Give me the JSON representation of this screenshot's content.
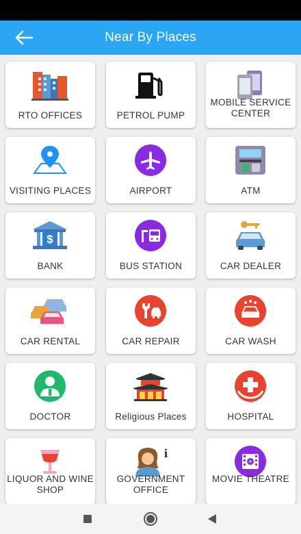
{
  "app_bar": {
    "title": "Near By Places"
  },
  "tiles": [
    {
      "label": "RTO OFFICES",
      "icon": "office-building-icon"
    },
    {
      "label": "PETROL PUMP",
      "icon": "fuel-pump-icon"
    },
    {
      "label": "MOBILE SERVICE CENTER",
      "icon": "mobile-phones-icon"
    },
    {
      "label": "VISITING PLACES",
      "icon": "map-pin-icon"
    },
    {
      "label": "AIRPORT",
      "icon": "airplane-icon"
    },
    {
      "label": "ATM",
      "icon": "atm-machine-icon"
    },
    {
      "label": "BANK",
      "icon": "bank-icon"
    },
    {
      "label": "BUS STATION",
      "icon": "bus-station-icon"
    },
    {
      "label": "CAR DEALER",
      "icon": "car-key-icon"
    },
    {
      "label": "CAR RENTAL",
      "icon": "cars-icon"
    },
    {
      "label": "CAR REPAIR",
      "icon": "car-wrench-icon"
    },
    {
      "label": "CAR WASH",
      "icon": "car-wash-icon"
    },
    {
      "label": "DOCTOR",
      "icon": "doctor-icon"
    },
    {
      "label": "Religious Places",
      "icon": "temple-icon"
    },
    {
      "label": "HOSPITAL",
      "icon": "hospital-cross-icon"
    },
    {
      "label": "LIQUOR AND WINE SHOP",
      "icon": "wine-glass-icon"
    },
    {
      "label": "GOVERNMENT OFFICE",
      "icon": "government-officer-icon"
    },
    {
      "label": "MOVIE THEATRE",
      "icon": "movie-film-icon"
    }
  ],
  "colors": {
    "app_bar": "#2aa6f3",
    "icon_purple": "#8a2be2",
    "icon_red": "#e8432e",
    "icon_green": "#1fb96b",
    "icon_blue": "#1e90ff"
  }
}
